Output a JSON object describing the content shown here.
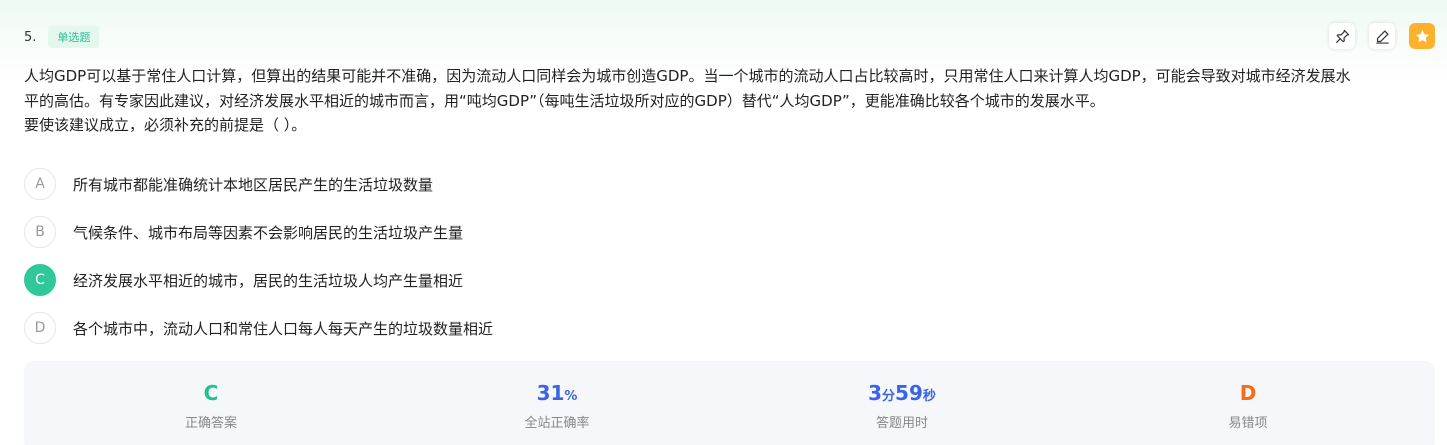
{
  "question": {
    "number": "5.",
    "type": "单选题",
    "stem_line1": "人均GDP可以基于常住人口计算，但算出的结果可能并不准确，因为流动人口同样会为城市创造GDP。当一个城市的流动人口占比较高时，只用常住人口来计算人均GDP，可能会导致对城市经济发展水",
    "stem_line2": "平的高估。有专家因此建议，对经济发展水平相近的城市而言，用“吨均GDP”（每吨生活垃圾所对应的GDP）替代“人均GDP”，更能准确比较各个城市的发展水平。",
    "stem_line3": "要使该建议成立，必须补充的前提是（ ）。"
  },
  "options": [
    {
      "letter": "A",
      "text": "所有城市都能准确统计本地区居民产生的生活垃圾数量"
    },
    {
      "letter": "B",
      "text": "气候条件、城市布局等因素不会影响居民的生活垃圾产生量"
    },
    {
      "letter": "C",
      "text": "经济发展水平相近的城市，居民的生活垃圾人均产生量相近"
    },
    {
      "letter": "D",
      "text": "各个城市中，流动人口和常住人口每人每天产生的垃圾数量相近"
    }
  ],
  "selected_option": "C",
  "stats": {
    "correct_answer": {
      "value": "C",
      "label": "正确答案"
    },
    "accuracy": {
      "value": "31",
      "unit": "%",
      "label": "全站正确率"
    },
    "time": {
      "min": "3",
      "min_unit": "分",
      "sec": "59",
      "sec_unit": "秒",
      "label": "答题用时"
    },
    "common_wrong": {
      "value": "D",
      "label": "易错项"
    }
  },
  "colors": {
    "accent_green": "#30c79a",
    "blue": "#3a64e8",
    "orange": "#fb6a15",
    "star": "#fdb22d"
  },
  "icons": [
    "pin-icon",
    "edit-icon",
    "star-icon"
  ]
}
